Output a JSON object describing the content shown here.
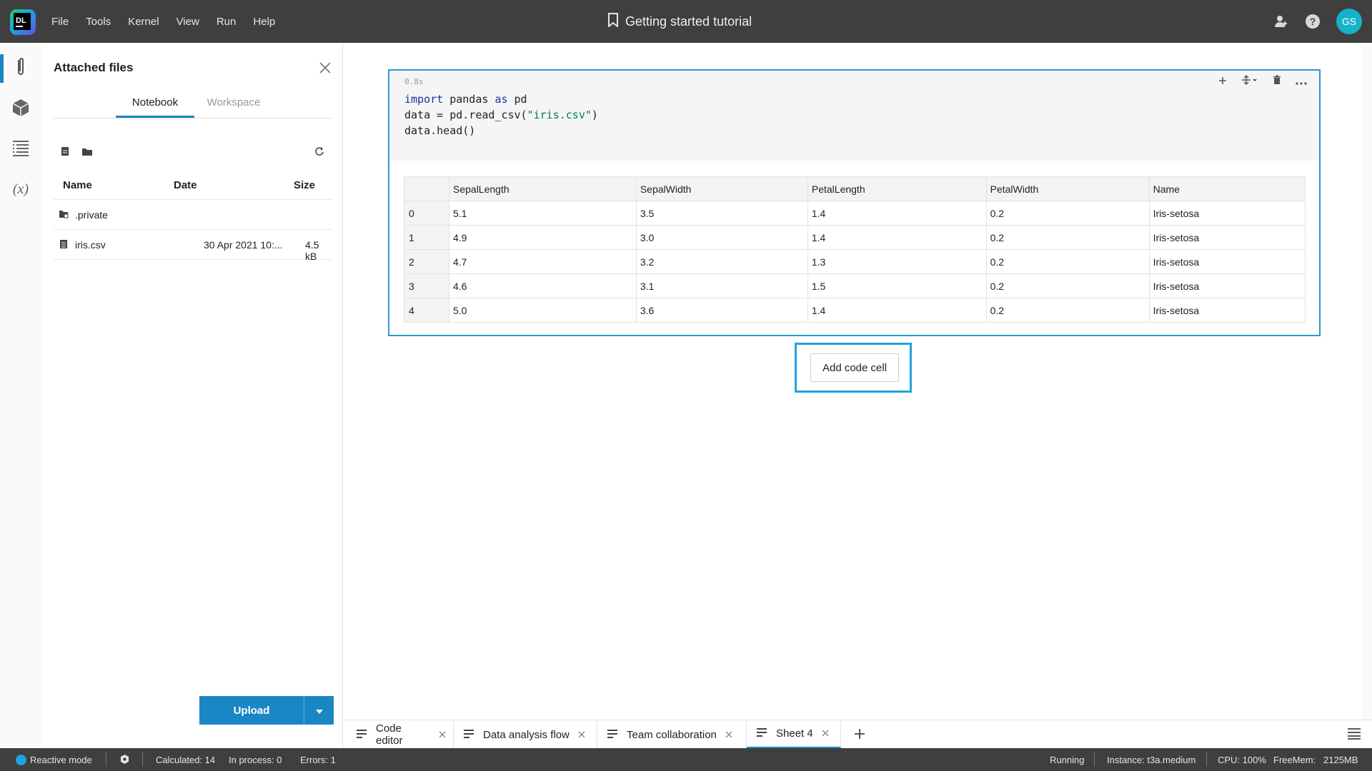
{
  "menu": [
    "File",
    "Tools",
    "Kernel",
    "View",
    "Run",
    "Help"
  ],
  "notebook_title": "Getting started tutorial",
  "user_initials": "GS",
  "panel": {
    "title": "Attached files",
    "tabs": [
      "Notebook",
      "Workspace"
    ],
    "columns": [
      "Name",
      "Date",
      "Size"
    ],
    "files": [
      {
        "name": ".private",
        "date": "",
        "size": ""
      },
      {
        "name": "iris.csv",
        "date": "30 Apr 2021 10:...",
        "size": "4.5 kB"
      }
    ],
    "upload_label": "Upload"
  },
  "cell": {
    "exec_time": "0.8s",
    "code": [
      {
        "kw": "import",
        "rest": " pandas ",
        "kw2": "as",
        "rest2": " pd"
      },
      {
        "prefix": "data = pd.read_csv(",
        "str": "\"iris.csv\"",
        "suffix": ")"
      },
      {
        "line": "data.head()"
      }
    ],
    "table": {
      "columns": [
        "SepalLength",
        "SepalWidth",
        "PetalLength",
        "PetalWidth",
        "Name"
      ],
      "rows": [
        {
          "idx": "0",
          "v": [
            "5.1",
            "3.5",
            "1.4",
            "0.2",
            "Iris-setosa"
          ]
        },
        {
          "idx": "1",
          "v": [
            "4.9",
            "3.0",
            "1.4",
            "0.2",
            "Iris-setosa"
          ]
        },
        {
          "idx": "2",
          "v": [
            "4.7",
            "3.2",
            "1.3",
            "0.2",
            "Iris-setosa"
          ]
        },
        {
          "idx": "3",
          "v": [
            "4.6",
            "3.1",
            "1.5",
            "0.2",
            "Iris-setosa"
          ]
        },
        {
          "idx": "4",
          "v": [
            "5.0",
            "3.6",
            "1.4",
            "0.2",
            "Iris-setosa"
          ]
        }
      ]
    }
  },
  "add_cell_label": "Add code cell",
  "bottom_tabs": [
    "Code editor",
    "Data analysis flow",
    "Team collaboration",
    "Sheet 4"
  ],
  "status": {
    "mode": "Reactive mode",
    "calculated": "Calculated: 14",
    "in_process": "In process: 0",
    "errors": "Errors: 1",
    "running": "Running",
    "instance": "Instance: t3a.medium",
    "cpu": "CPU: 100%",
    "freemem": "FreeMem:",
    "freemem_value": "2125MB"
  },
  "colors": {
    "accent": "#1a86c4",
    "avatar": "#17b1c8",
    "topbar": "#3f3f3f",
    "highlight": "#1ea3e0"
  }
}
